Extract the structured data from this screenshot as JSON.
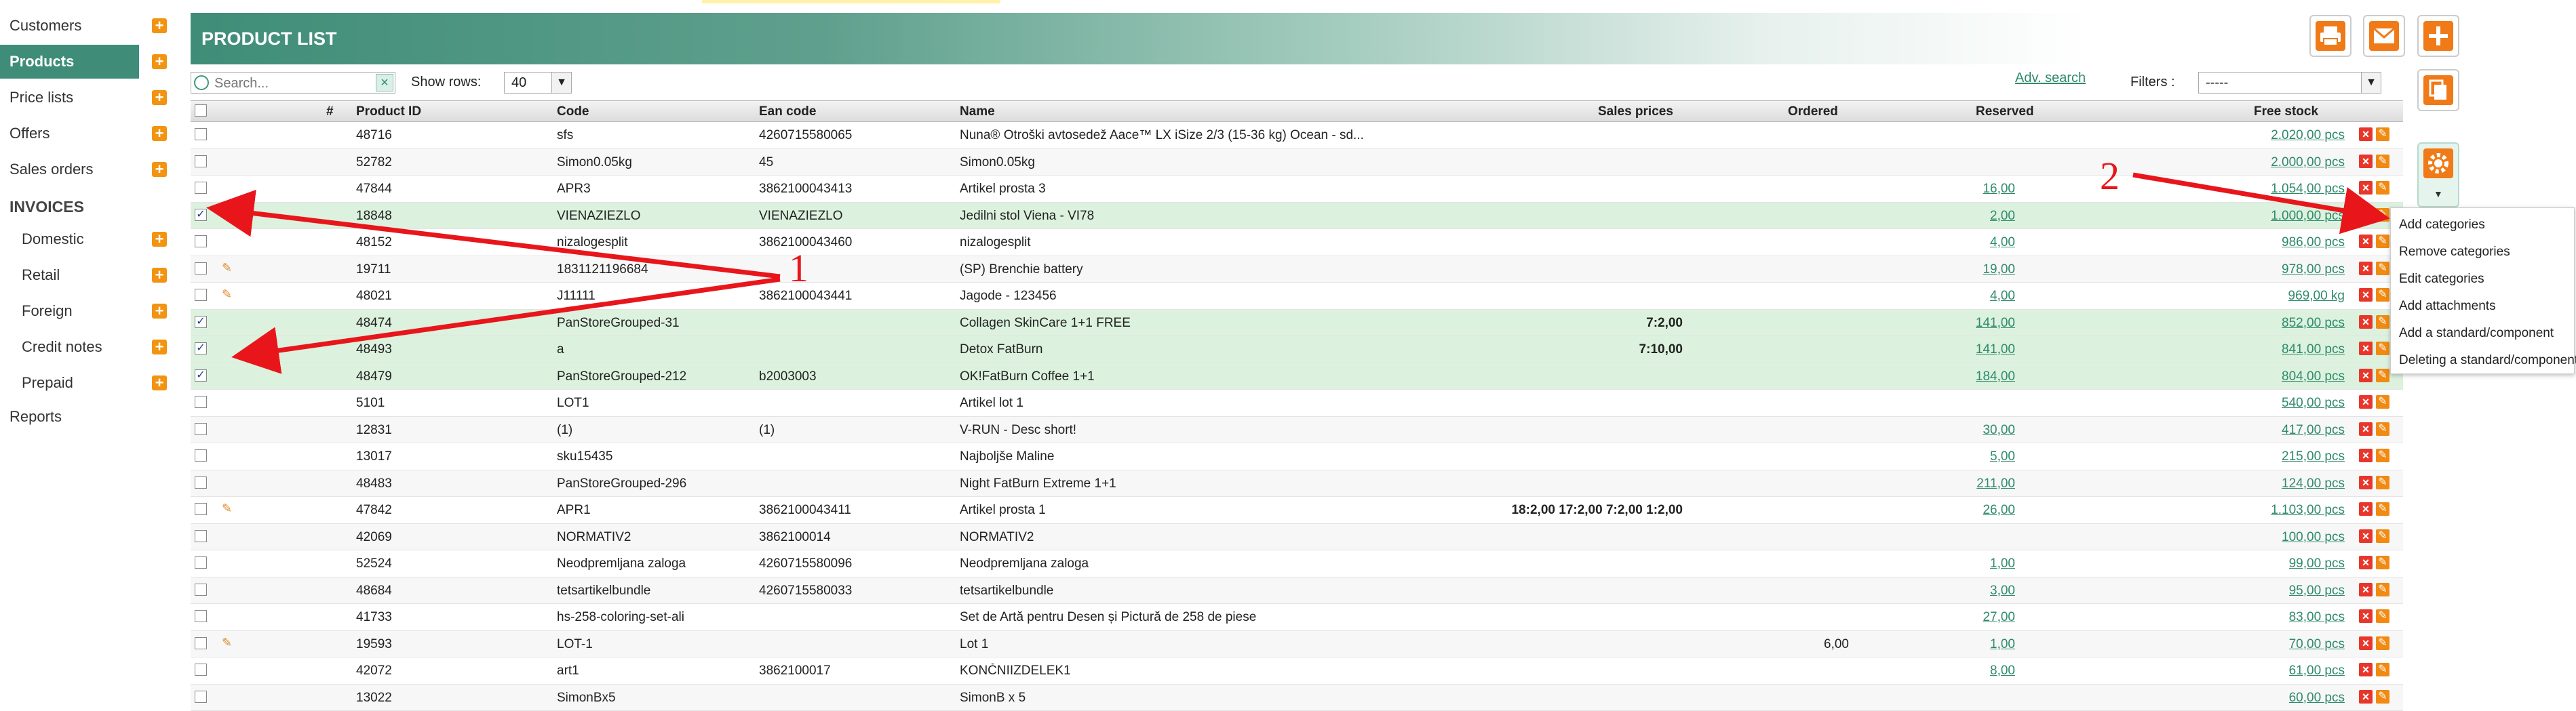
{
  "colors": {
    "accent": "#3f8d78",
    "orange": "#f07a17",
    "link": "#2f8a6c",
    "annotation": "#e8161b",
    "selected_row": "#dcf2de"
  },
  "sidebar": {
    "items": [
      {
        "label": "Customers",
        "has_add": true
      },
      {
        "label": "Products",
        "has_add": true,
        "active": true
      },
      {
        "label": "Price lists",
        "has_add": true
      },
      {
        "label": "Offers",
        "has_add": true
      },
      {
        "label": "Sales orders",
        "has_add": true
      }
    ],
    "section_title": "INVOICES",
    "sub_items": [
      {
        "label": "Domestic",
        "has_add": true
      },
      {
        "label": "Retail",
        "has_add": true
      },
      {
        "label": "Foreign",
        "has_add": true
      },
      {
        "label": "Credit notes",
        "has_add": true
      },
      {
        "label": "Prepaid",
        "has_add": true
      }
    ],
    "reports": "Reports"
  },
  "header": {
    "title": "PRODUCT LIST",
    "buttons": [
      "printer-icon",
      "mail-icon",
      "plus-icon",
      "copy-icon",
      "gear-icon"
    ]
  },
  "toolbar": {
    "search_placeholder": "Search...",
    "clear": "×",
    "show_rows_label": "Show rows:",
    "show_rows_value": "40",
    "adv_search": "Adv. search",
    "filters_label": "Filters :",
    "filters_value": "-----"
  },
  "table": {
    "headers": [
      "#",
      "Product ID",
      "Code",
      "Ean code",
      "Name",
      "Sales prices",
      "Ordered",
      "Reserved",
      "Free stock"
    ],
    "rows": [
      {
        "checked": false,
        "clip": false,
        "id": "48716",
        "code": "sfs",
        "ean": "4260715580065",
        "name": "Nuna® Otroški avtosedež Aace™ LX iSize 2/3 (15-36 kg) Ocean - sd...",
        "prices": "",
        "ordered": "",
        "reserved": "",
        "stock": "2.020,00 pcs"
      },
      {
        "checked": false,
        "clip": false,
        "id": "52782",
        "code": "Simon0.05kg",
        "ean": "45",
        "name": "Simon0.05kg",
        "prices": "",
        "ordered": "",
        "reserved": "",
        "stock": "2.000,00 pcs"
      },
      {
        "checked": false,
        "clip": false,
        "id": "47844",
        "code": "APR3",
        "ean": "3862100043413",
        "name": "Artikel prosta 3",
        "prices": "",
        "ordered": "",
        "reserved": "16,00",
        "stock": "1.054,00 pcs"
      },
      {
        "checked": true,
        "clip": true,
        "id": "18848",
        "code": "VIENAZIEZLO",
        "ean": "VIENAZIEZLO",
        "name": "Jedilni stol Viena - VI78",
        "prices": "",
        "ordered": "",
        "reserved": "2,00",
        "stock": "1.000,00 pcs"
      },
      {
        "checked": false,
        "clip": false,
        "id": "48152",
        "code": "nizalogesplit",
        "ean": "3862100043460",
        "name": "nizalogesplit",
        "prices": "",
        "ordered": "",
        "reserved": "4,00",
        "stock": "986,00 pcs"
      },
      {
        "checked": false,
        "clip": true,
        "id": "19711",
        "code": "1831121196684",
        "ean": "",
        "name": "(SP) Brenchie battery",
        "prices": "",
        "ordered": "",
        "reserved": "19,00",
        "stock": "978,00 pcs"
      },
      {
        "checked": false,
        "clip": true,
        "id": "48021",
        "code": "J11111",
        "ean": "3862100043441",
        "name": "Jagode - 123456",
        "prices": "",
        "ordered": "",
        "reserved": "4,00",
        "stock": "969,00 kg"
      },
      {
        "checked": true,
        "clip": false,
        "id": "48474",
        "code": "PanStoreGrouped-31",
        "ean": "",
        "name": "Collagen SkinCare 1+1 FREE",
        "prices": "7:2,00",
        "ordered": "",
        "reserved": "141,00",
        "stock": "852,00 pcs"
      },
      {
        "checked": true,
        "clip": false,
        "id": "48493",
        "code": "a",
        "ean": "",
        "name": "Detox FatBurn",
        "prices": "7:10,00",
        "ordered": "",
        "reserved": "141,00",
        "stock": "841,00 pcs"
      },
      {
        "checked": true,
        "clip": false,
        "id": "48479",
        "code": "PanStoreGrouped-212",
        "ean": "b2003003",
        "name": "OK!FatBurn Coffee 1+1",
        "prices": "",
        "ordered": "",
        "reserved": "184,00",
        "stock": "804,00 pcs"
      },
      {
        "checked": false,
        "clip": false,
        "id": "5101",
        "code": "LOT1",
        "ean": "",
        "name": "Artikel lot 1",
        "prices": "",
        "ordered": "",
        "reserved": "",
        "stock": "540,00 pcs"
      },
      {
        "checked": false,
        "clip": false,
        "id": "12831",
        "code": "(1)",
        "ean": "(1)",
        "name": "V-RUN - Desc short!",
        "prices": "",
        "ordered": "",
        "reserved": "30,00",
        "stock": "417,00 pcs"
      },
      {
        "checked": false,
        "clip": false,
        "id": "13017",
        "code": "sku15435",
        "ean": "",
        "name": "Najboljše Maline",
        "prices": "",
        "ordered": "",
        "reserved": "5,00",
        "stock": "215,00 pcs"
      },
      {
        "checked": false,
        "clip": false,
        "id": "48483",
        "code": "PanStoreGrouped-296",
        "ean": "",
        "name": "Night FatBurn Extreme 1+1",
        "prices": "",
        "ordered": "",
        "reserved": "211,00",
        "stock": "124,00 pcs"
      },
      {
        "checked": false,
        "clip": true,
        "id": "47842",
        "code": "APR1",
        "ean": "3862100043411",
        "name": "Artikel prosta 1",
        "prices": "18:2,00 17:2,00 7:2,00 1:2,00",
        "ordered": "",
        "reserved": "26,00",
        "stock": "1.103,00 pcs"
      },
      {
        "checked": false,
        "clip": false,
        "id": "42069",
        "code": "NORMATIV2",
        "ean": "3862100014",
        "name": "NORMATIV2",
        "prices": "",
        "ordered": "",
        "reserved": "",
        "stock": "100,00 pcs"
      },
      {
        "checked": false,
        "clip": false,
        "id": "52524",
        "code": "Neodpremljana zaloga",
        "ean": "4260715580096",
        "name": "Neodpremljana zaloga",
        "prices": "",
        "ordered": "",
        "reserved": "1,00",
        "stock": "99,00 pcs"
      },
      {
        "checked": false,
        "clip": false,
        "id": "48684",
        "code": "tetsartikelbundle",
        "ean": "4260715580033",
        "name": "tetsartikelbundle",
        "prices": "",
        "ordered": "",
        "reserved": "3,00",
        "stock": "95,00 pcs"
      },
      {
        "checked": false,
        "clip": false,
        "id": "41733",
        "code": "hs-258-coloring-set-ali",
        "ean": "",
        "name": "Set de Artă pentru Desen și Pictură de 258 de piese",
        "prices": "",
        "ordered": "",
        "reserved": "27,00",
        "stock": "83,00 pcs"
      },
      {
        "checked": false,
        "clip": true,
        "id": "19593",
        "code": "LOT-1",
        "ean": "",
        "name": "Lot 1",
        "prices": "",
        "ordered": "6,00",
        "reserved": "1,00",
        "stock": "70,00 pcs"
      },
      {
        "checked": false,
        "clip": false,
        "id": "42072",
        "code": "art1",
        "ean": "3862100017",
        "name": "KONČNIIZDELEK1",
        "prices": "",
        "ordered": "",
        "reserved": "8,00",
        "stock": "61,00 pcs"
      },
      {
        "checked": false,
        "clip": false,
        "id": "13022",
        "code": "SimonBx5",
        "ean": "",
        "name": "SimonB x 5",
        "prices": "",
        "ordered": "",
        "reserved": "",
        "stock": "60,00 pcs"
      }
    ]
  },
  "menu": {
    "items": [
      "Add categories",
      "Remove categories",
      "Edit categories",
      "Add attachments",
      "Add a standard/component",
      "Deleting a standard/component"
    ]
  },
  "annotations": {
    "label1": "1",
    "label2": "2"
  }
}
